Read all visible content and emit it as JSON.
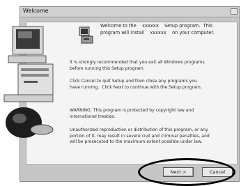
{
  "window": {
    "title": "Welcome"
  },
  "welcome_text": "Welcome to the    xxxxxx    Setup program.  This\nprogram will install    xxxxxx    on your computer.",
  "paragraphs": [
    "It is strongly recommended that you exit all Windows programs\nbefore running this Setup program.",
    "Click Cancel to quit Setup and then close any programs you\nhave running.  Click Next to continue with the Setup program.",
    "WARNING: This program is protected by copyright law and\ninternational treaties.",
    "Unauthorized reproduction or distribution of this program, or any\nportion of it, may result in severe civil and criminal penalties, and\nwill be prosecuted to the maximum extent possible under law."
  ],
  "buttons": {
    "next": "Next >",
    "cancel": "Cancel"
  }
}
